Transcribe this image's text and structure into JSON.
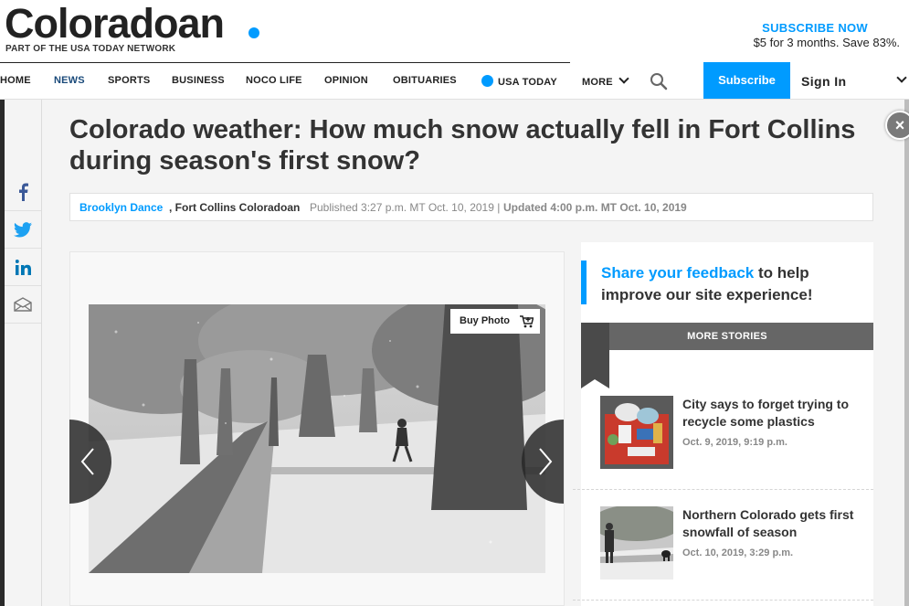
{
  "header": {
    "logo": "Coloradoan",
    "network": "PART OF THE USA TODAY NETWORK",
    "subscribe_now": "SUBSCRIBE NOW",
    "offer": "$5 for 3 months. Save 83%."
  },
  "nav": {
    "items": [
      "HOME",
      "NEWS",
      "SPORTS",
      "BUSINESS",
      "NOCO LIFE",
      "OPINION",
      "OBITUARIES",
      "USA TODAY",
      "MORE"
    ],
    "subscribe": "Subscribe",
    "sign_in": "Sign In"
  },
  "article": {
    "headline": "Colorado weather: How much snow actually fell in Fort Collins during season's first snow?",
    "author": "Brooklyn Dance",
    "org": ", Fort Collins Coloradoan",
    "published": "Published 3:27 p.m. MT Oct. 10, 2019 |",
    "updated": "Updated 4:00 p.m. MT Oct. 10, 2019",
    "buy_photo": "Buy Photo"
  },
  "share": [
    "facebook-icon",
    "twitter-icon",
    "linkedin-icon",
    "email-icon"
  ],
  "rail": {
    "feedback_link": "Share your feedback",
    "feedback_rest": " to help improve our site experience!",
    "more_stories": "MORE STORIES",
    "stories": [
      {
        "title": "City says to forget trying to recycle some plastics",
        "date": "Oct. 9, 2019, 9:19 p.m."
      },
      {
        "title": "Northern Colorado gets first snowfall of season",
        "date": "Oct. 10, 2019, 3:29 p.m."
      }
    ]
  },
  "colors": {
    "accent": "#009bff",
    "text": "#333333"
  }
}
